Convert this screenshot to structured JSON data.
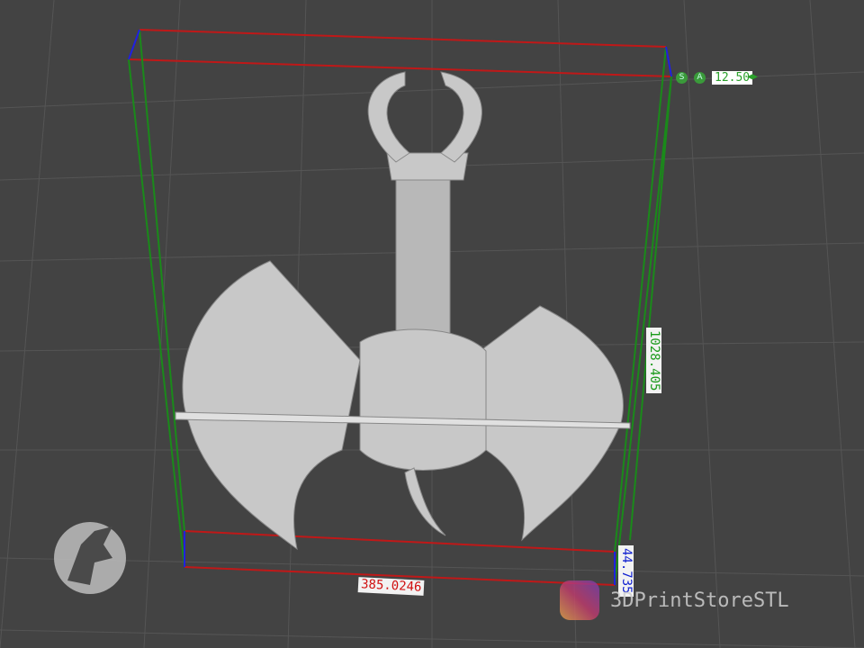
{
  "viewer": {
    "scale_s_label": "S",
    "scale_a_label": "A",
    "scale_value": "12.50",
    "dimension_x": "385.0246",
    "dimension_y": "1028.405",
    "dimension_z": "44.735"
  },
  "watermark": {
    "logo_text": "3D Print Store STL",
    "instagram_handle": "3DPrintStoreSTL"
  },
  "colors": {
    "x_axis": "#d01010",
    "y_axis": "#1a9a1a",
    "z_axis": "#1020d0",
    "background": "#434343"
  }
}
